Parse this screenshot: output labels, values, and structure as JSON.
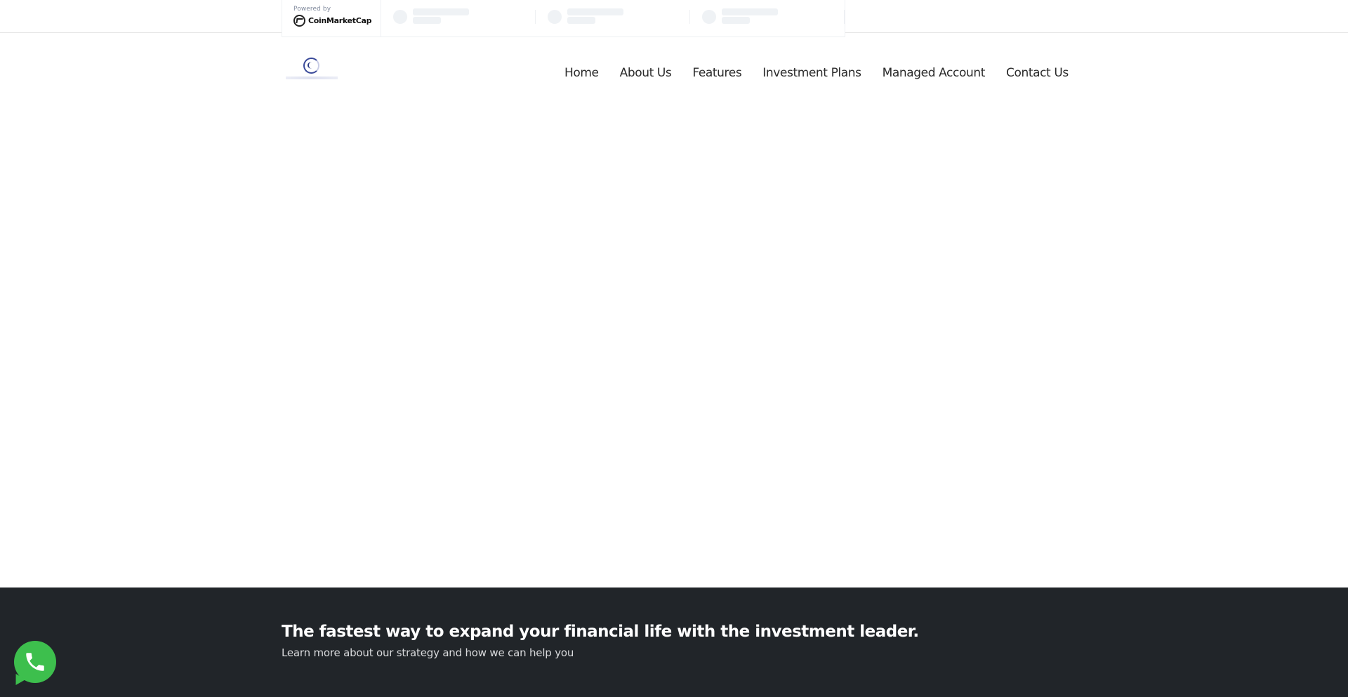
{
  "ticker": {
    "powered_label": "Powered by",
    "brand": "CoinMarketCap"
  },
  "nav": {
    "items": [
      {
        "label": "Home"
      },
      {
        "label": "About Us"
      },
      {
        "label": "Features"
      },
      {
        "label": "Investment Plans"
      },
      {
        "label": "Managed Account"
      },
      {
        "label": "Contact Us"
      }
    ]
  },
  "footer": {
    "title": "The fastest way to expand your financial life with the investment leader.",
    "subtitle": "Learn more about our strategy and how we can help you"
  },
  "icons": {
    "cmc": "coinmarketcap-logo-icon",
    "whatsapp": "whatsapp-phone-icon"
  },
  "colors": {
    "footer_bg": "#212529",
    "whatsapp": "#3dbf4d",
    "logo": "#3a4a9a"
  }
}
